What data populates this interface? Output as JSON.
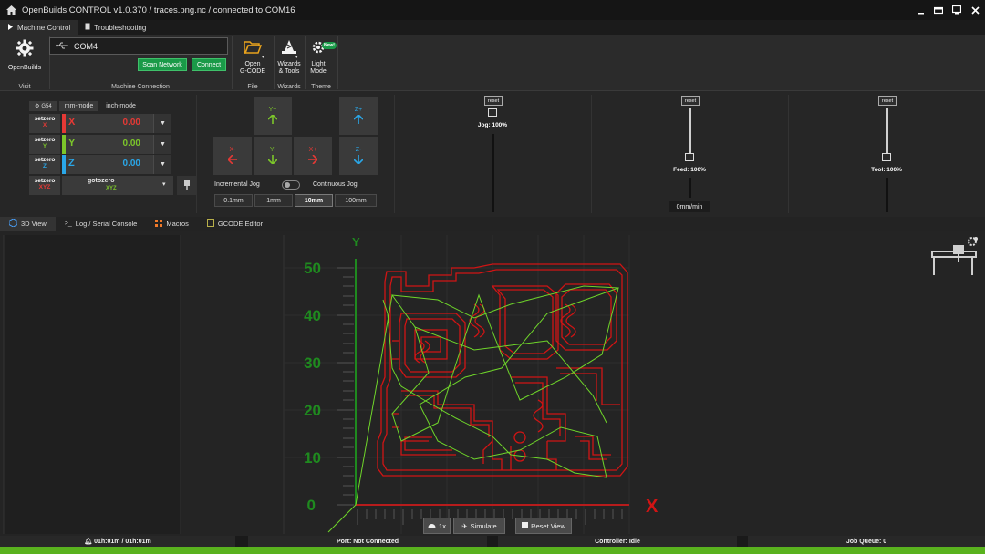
{
  "window": {
    "title": "OpenBuilds CONTROL v1.0.370 / traces.png.nc / connected to COM16",
    "controls": [
      "minimize",
      "restore",
      "maximize",
      "close"
    ]
  },
  "top_tabs": [
    {
      "label": "Machine Control",
      "icon": "play-icon",
      "active": true
    },
    {
      "label": "Troubleshooting",
      "icon": "document-icon",
      "active": false
    }
  ],
  "ribbon": {
    "visit": {
      "button_label": "OpenBuilds",
      "group_label": "Visit"
    },
    "connection": {
      "port_value": "COM4",
      "scan_label": "Scan Network",
      "connect_label": "Connect",
      "group_label": "Machine Connection"
    },
    "file": {
      "open_label_1": "Open",
      "open_label_2": "G-CODE",
      "group_label": "File"
    },
    "wizards": {
      "label_1": "Wizards",
      "label_2": "& Tools",
      "group_label": "Wizards"
    },
    "theme": {
      "label_1": "Light",
      "label_2": "Mode",
      "new_badge": "New!",
      "group_label": "Theme"
    }
  },
  "dro": {
    "tabs": {
      "wcs": "G54",
      "mm": "mm-mode",
      "inch": "inch-mode"
    },
    "setzero_label": "setzero",
    "rows": [
      {
        "axis": "X",
        "value": "0.00",
        "color": "#e53935"
      },
      {
        "axis": "Y",
        "value": "0.00",
        "color": "#7cc62a"
      },
      {
        "axis": "Z",
        "value": "0.00",
        "color": "#2aa7e8"
      }
    ],
    "all": {
      "setzero_axes": "XYZ",
      "gotozero_label": "gotozero",
      "gotozero_axes": "XYZ"
    }
  },
  "jog": {
    "yplus": "Y+",
    "yminus": "Y-",
    "xplus": "X+",
    "xminus": "X-",
    "zplus": "Z+",
    "zminus": "Z-",
    "incremental_label": "Incremental Jog",
    "continuous_label": "Continuous Jog",
    "steps": [
      "0.1mm",
      "1mm",
      "10mm",
      "100mm"
    ],
    "active_step": "10mm"
  },
  "overrides": {
    "reset_label": "reset",
    "jog_label": "Jog: 100%",
    "feed_label": "Feed: 100%",
    "feed_rate": "0mm/min",
    "tool_label": "Tool: 100%"
  },
  "view_tabs": [
    {
      "label": "3D View",
      "active": true
    },
    {
      "label": "Log / Serial Console",
      "active": false
    },
    {
      "label": "Macros",
      "active": false
    },
    {
      "label": "GCODE Editor",
      "active": false
    }
  ],
  "viewer": {
    "y_axis_label": "Y",
    "x_axis_label": "X",
    "y_ticks": [
      "50",
      "40",
      "30",
      "20",
      "10",
      "0"
    ],
    "speed_label": "1x",
    "simulate_label": "Simulate",
    "reset_view_label": "Reset View"
  },
  "status": {
    "timer": "01h:01m / 01h:01m",
    "port": "Port: Not Connected",
    "controller": "Controller: Idle",
    "queue": "Job Queue: 0"
  },
  "colors": {
    "accent_green": "#1a9a48",
    "trace_red": "#d11414",
    "path_green": "#6fd62a",
    "axis_green": "#1f8a1f"
  }
}
